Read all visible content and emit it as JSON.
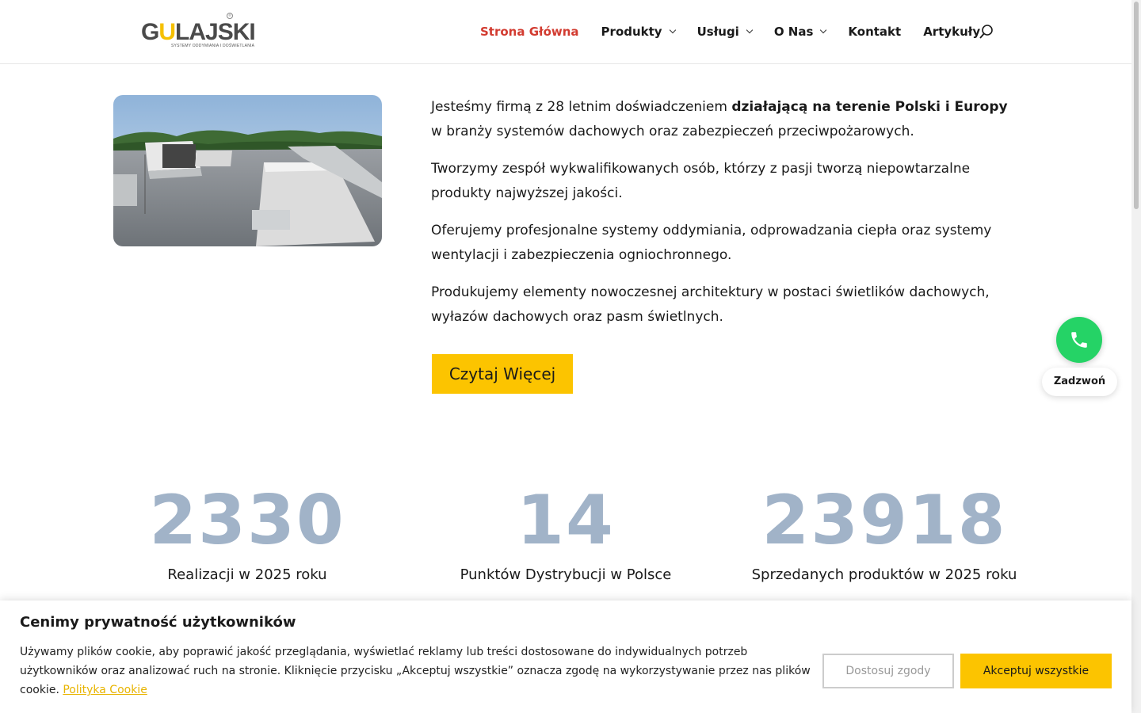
{
  "header": {
    "logo": {
      "text_g": "G",
      "text_u": "U",
      "text_rest": "LAJSKI",
      "tagline": "SYSTEMY ODDYMIANIA I DOŚWIETLANIA"
    },
    "nav": [
      {
        "label": "Strona Główna",
        "active": true,
        "dropdown": false
      },
      {
        "label": "Produkty",
        "active": false,
        "dropdown": true
      },
      {
        "label": "Usługi",
        "active": false,
        "dropdown": true
      },
      {
        "label": "O Nas",
        "active": false,
        "dropdown": true
      },
      {
        "label": "Kontakt",
        "active": false,
        "dropdown": false
      },
      {
        "label": "Artykuły",
        "active": false,
        "dropdown": false
      }
    ]
  },
  "about": {
    "p1_normal": "Jesteśmy firmą z 28 letnim doświadczeniem ",
    "p1_bold": "działającą na terenie Polski i Europy",
    "p1_end": " w branży systemów dachowych oraz zabezpieczeń przeciwpożarowych.",
    "p2": "Tworzymy zespół wykwalifikowanych osób, którzy z pasji tworzą niepowtarzalne produkty najwyższej jakości.",
    "p3": "Oferujemy profesjonalne systemy oddymiania, odprowadzania ciepła oraz systemy wentylacji i zabezpieczenia ogniochronnego.",
    "p4": "Produkujemy elementy nowoczesnej architektury w postaci świetlików dachowych, wyłazów dachowych oraz pasm świetlnych.",
    "button": "Czytaj Więcej"
  },
  "stats": [
    {
      "value": "2330",
      "label": "Realizacji w 2025 roku"
    },
    {
      "value": "14",
      "label": "Punktów Dystrybucji w Polsce"
    },
    {
      "value": "23918",
      "label": "Sprzedanych produktów w 2025 roku"
    }
  ],
  "call": {
    "label": "Zadzwoń"
  },
  "cookie": {
    "title": "Cenimy prywatność użytkowników",
    "text": "Używamy plików cookie, aby poprawić jakość przeglądania, wyświetlać reklamy lub treści dostosowane do indywidualnych potrzeb użytkowników oraz analizować ruch na stronie. Kliknięcie przycisku „Akceptuj wszystkie” oznacza zgodę na wykorzystywanie przez nas plików cookie. ",
    "link": "Polityka Cookie",
    "customize": "Dostosuj zgody",
    "accept": "Akceptuj wszystkie"
  },
  "colors": {
    "accent_yellow": "#fcc400",
    "nav_active": "#d23b30",
    "stat_number": "#a1b3c8",
    "call_green": "#25d366"
  }
}
